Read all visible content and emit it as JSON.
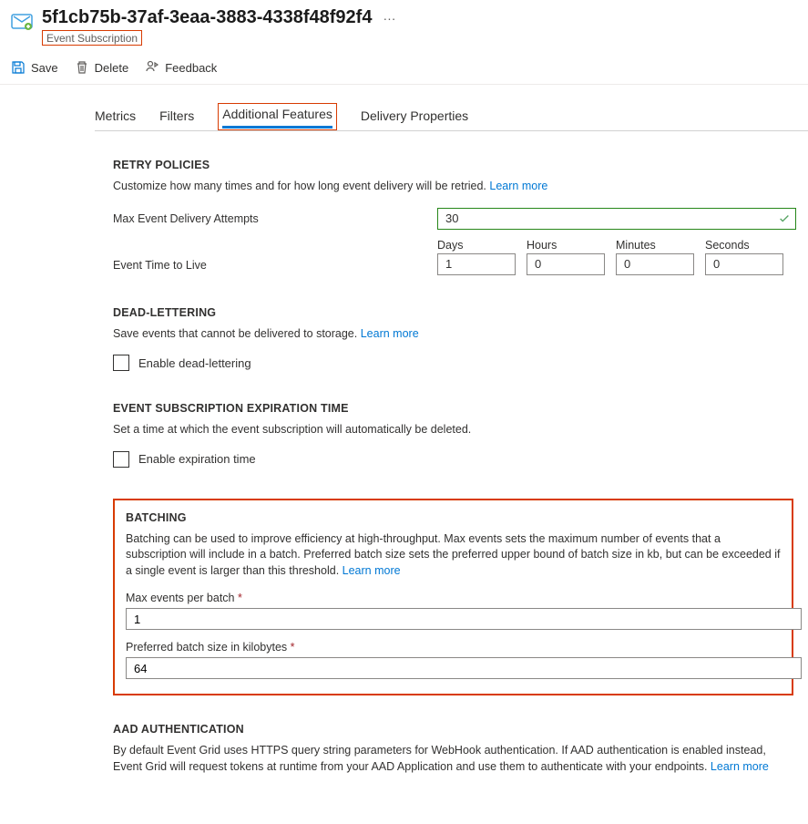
{
  "header": {
    "title": "5f1cb75b-37af-3eaa-3883-4338f48f92f4",
    "subtitle": "Event Subscription"
  },
  "toolbar": {
    "save": "Save",
    "delete": "Delete",
    "feedback": "Feedback"
  },
  "tabs": {
    "metrics": "Metrics",
    "filters": "Filters",
    "additional": "Additional Features",
    "delivery": "Delivery Properties"
  },
  "retry": {
    "title": "RETRY POLICIES",
    "desc": "Customize how many times and for how long event delivery will be retried.",
    "learn": "Learn more",
    "maxAttemptsLabel": "Max Event Delivery Attempts",
    "maxAttemptsValue": "30",
    "ttlLabel": "Event Time to Live",
    "days": "Days",
    "daysVal": "1",
    "hours": "Hours",
    "hoursVal": "0",
    "minutes": "Minutes",
    "minutesVal": "0",
    "seconds": "Seconds",
    "secondsVal": "0"
  },
  "deadletter": {
    "title": "DEAD-LETTERING",
    "desc": "Save events that cannot be delivered to storage.",
    "learn": "Learn more",
    "checkbox": "Enable dead-lettering"
  },
  "expiration": {
    "title": "EVENT SUBSCRIPTION EXPIRATION TIME",
    "desc": "Set a time at which the event subscription will automatically be deleted.",
    "checkbox": "Enable expiration time"
  },
  "batching": {
    "title": "BATCHING",
    "desc": "Batching can be used to improve efficiency at high-throughput. Max events sets the maximum number of events that a subscription will include in a batch. Preferred batch size sets the preferred upper bound of batch size in kb, but can be exceeded if a single event is larger than this threshold.",
    "learn": "Learn more",
    "maxEventsLabel": "Max events per batch",
    "maxEventsValue": "1",
    "prefSizeLabel": "Preferred batch size in kilobytes",
    "prefSizeValue": "64"
  },
  "aad": {
    "title": "AAD AUTHENTICATION",
    "desc": "By default Event Grid uses HTTPS query string parameters for WebHook authentication. If AAD authentication is enabled instead, Event Grid will request tokens at runtime from your AAD Application and use them to authenticate with your endpoints.",
    "learn": "Learn more"
  }
}
